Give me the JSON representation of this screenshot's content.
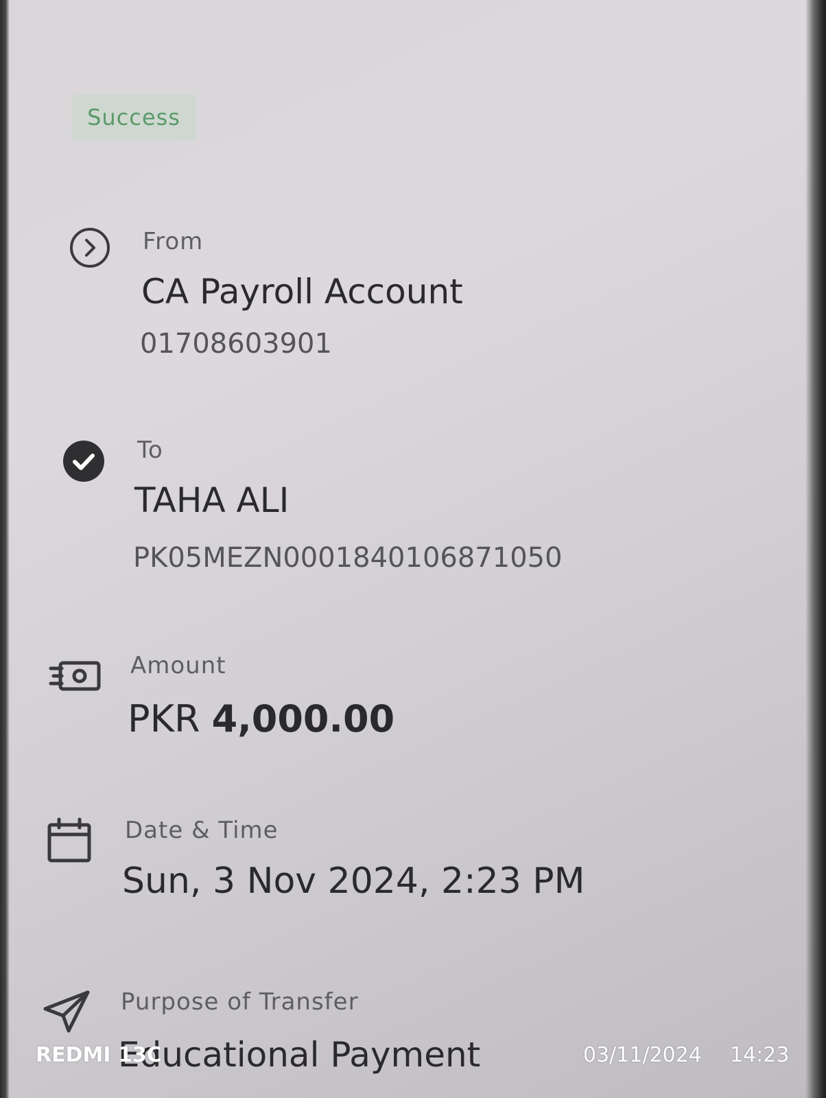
{
  "status": {
    "badge": "Success"
  },
  "from": {
    "label": "From",
    "name": "CA Payroll Account",
    "account": "01708603901",
    "icon": "chevron-right-circle-icon"
  },
  "to": {
    "label": "To",
    "name": "TAHA ALI",
    "account": "PK05MEZN0001840106871050",
    "icon": "check-circle-icon"
  },
  "amount": {
    "label": "Amount",
    "currency": "PKR",
    "value": "4,000.00",
    "icon": "banknote-icon"
  },
  "datetime": {
    "label": "Date & Time",
    "value": "Sun, 3 Nov 2024, 2:23 PM",
    "icon": "calendar-icon"
  },
  "purpose": {
    "label": "Purpose of Transfer",
    "value": "Educational Payment",
    "icon": "send-icon"
  },
  "camera_watermark": {
    "device": "REDMI 13C",
    "date": "03/11/2024",
    "time": "14:23"
  },
  "colors": {
    "success_text": "#5a9a6a",
    "success_bg": "#cfd8d0",
    "text_primary": "#2a2a2c",
    "text_secondary": "#5e5e60"
  }
}
